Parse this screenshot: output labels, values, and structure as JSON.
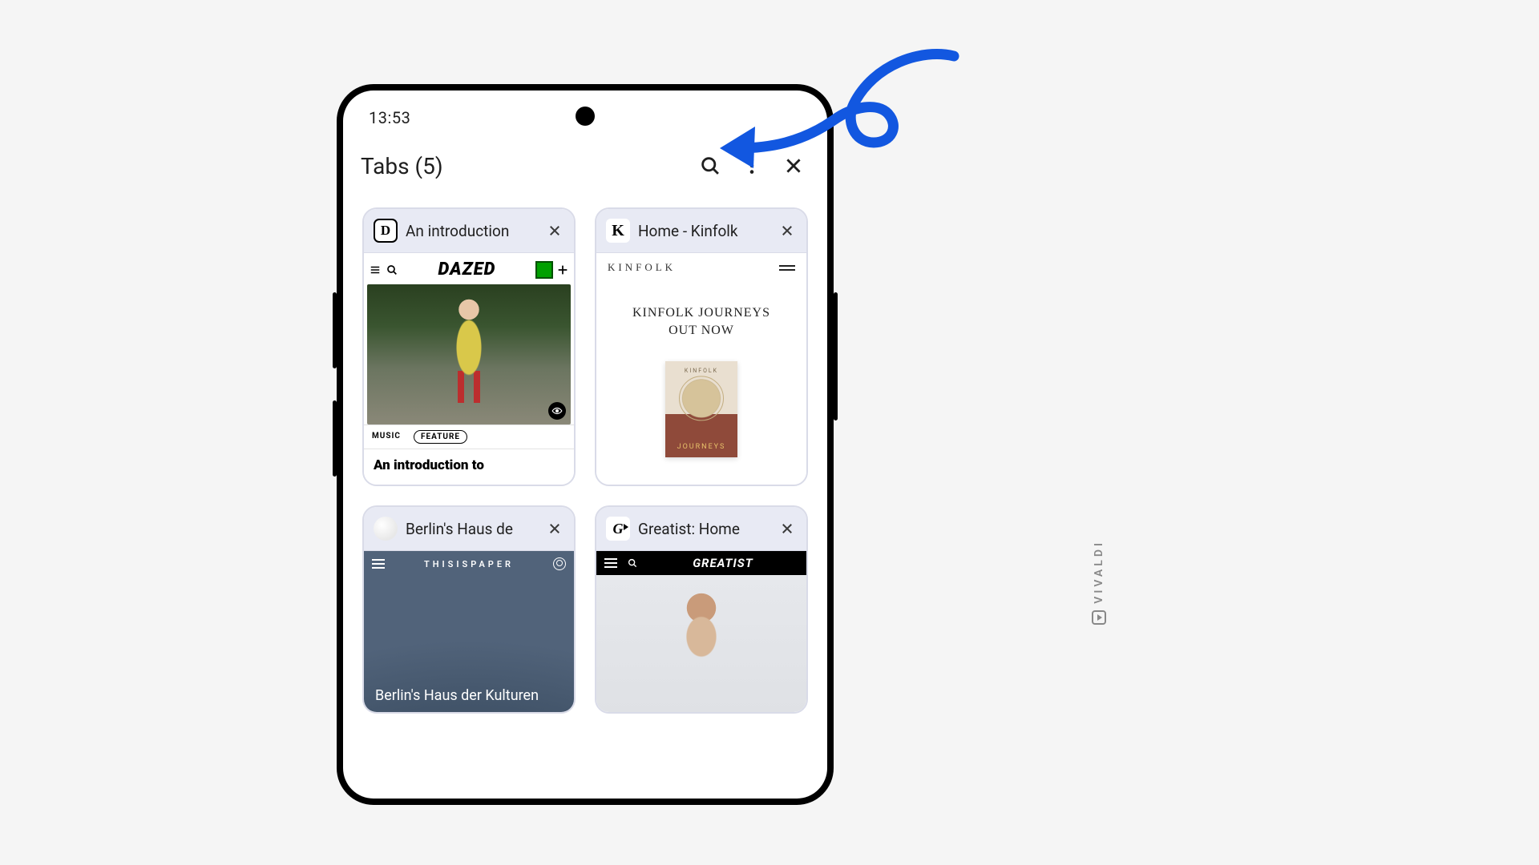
{
  "status": {
    "time": "13:53"
  },
  "header": {
    "title": "Tabs (5)"
  },
  "tabs": [
    {
      "title": "An introduction",
      "favicon_letter": "D",
      "preview": {
        "brand": "DAZED",
        "tag_category": "MUSIC",
        "tag_type": "FEATURE",
        "headline": "An introduction to"
      }
    },
    {
      "title": "Home - Kinfolk",
      "favicon_letter": "K",
      "preview": {
        "brand": "KINFOLK",
        "hero_line1": "KINFOLK JOURNEYS",
        "hero_line2": "OUT NOW",
        "book_top_label": "KINFOLK",
        "book_bottom_label": "JOURNEYS"
      }
    },
    {
      "title": "Berlin's Haus de",
      "preview": {
        "brand": "THISISPAPER",
        "headline": "Berlin's Haus der Kulturen"
      }
    },
    {
      "title": "Greatist: Home",
      "favicon_letter": "G",
      "preview": {
        "brand": "GREATIST"
      }
    }
  ],
  "watermark": "VIVALDI"
}
